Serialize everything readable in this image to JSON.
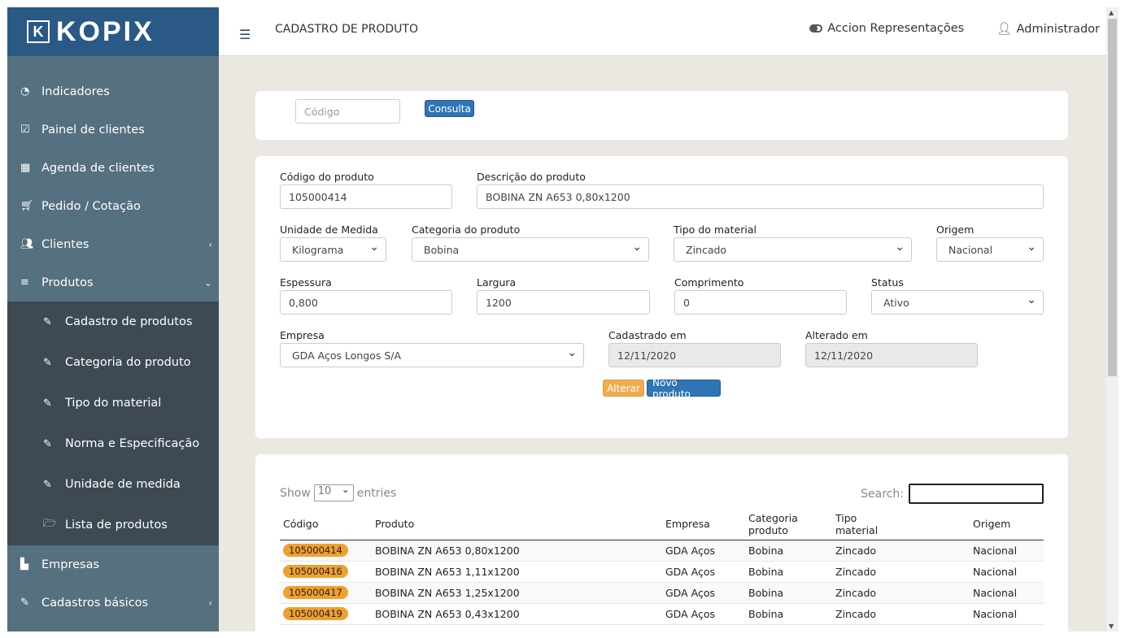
{
  "brand": {
    "mark": "K",
    "name": "KOPIX"
  },
  "header": {
    "title": "CADASTRO DE PRODUTO",
    "company": "Accion Representações",
    "user": "Administrador"
  },
  "sidebar": {
    "items": [
      {
        "label": "Indicadores",
        "icon": "dashboard-icon"
      },
      {
        "label": "Painel de clientes",
        "icon": "check-square-icon"
      },
      {
        "label": "Agenda de clientes",
        "icon": "calendar-icon"
      },
      {
        "label": "Pedido / Cotação",
        "icon": "cart-icon"
      },
      {
        "label": "Clientes",
        "icon": "users-icon"
      },
      {
        "label": "Produtos",
        "icon": "bars-icon"
      }
    ],
    "sub_items": [
      {
        "label": "Cadastro de produtos"
      },
      {
        "label": "Categoria do produto"
      },
      {
        "label": "Tipo do material"
      },
      {
        "label": "Norma e Especificação"
      },
      {
        "label": "Unidade de medida"
      },
      {
        "label": "Lista de produtos"
      }
    ],
    "bottom_items": [
      {
        "label": "Empresas"
      },
      {
        "label": "Cadastros básicos"
      }
    ]
  },
  "search_card": {
    "code_placeholder": "Código",
    "consult_label": "Consulta"
  },
  "form": {
    "codigo_label": "Código do produto",
    "codigo_value": "105000414",
    "descricao_label": "Descrição do produto",
    "descricao_value": "BOBINA ZN A653 0,80x1200",
    "unidade_label": "Unidade de Medida",
    "unidade_value": "Kilograma",
    "categoria_label": "Categoria do produto",
    "categoria_value": "Bobina",
    "tipo_label": "Tipo do material",
    "tipo_value": "Zincado",
    "origem_label": "Origem",
    "origem_value": "Nacional",
    "espessura_label": "Espessura",
    "espessura_value": "0,800",
    "largura_label": "Largura",
    "largura_value": "1200",
    "comprimento_label": "Comprimento",
    "comprimento_value": "0",
    "status_label": "Status",
    "status_value": "Ativo",
    "empresa_label": "Empresa",
    "empresa_value": "GDA Aços Longos S/A",
    "cadastrado_label": "Cadastrado em",
    "cadastrado_value": "12/11/2020",
    "alterado_label": "Alterado em",
    "alterado_value": "12/11/2020",
    "alterar_label": "Alterar",
    "novo_label": "Novo produto"
  },
  "table": {
    "show_label": "Show",
    "show_value": "10",
    "entries_label": "entries",
    "search_label": "Search:",
    "headers": {
      "codigo": "Código",
      "produto": "Produto",
      "empresa": "Empresa",
      "categoria_1": "Categoria",
      "categoria_2": "produto",
      "tipo_1": "Tipo",
      "tipo_2": "material",
      "origem": "Origem"
    },
    "rows": [
      {
        "codigo": "105000414",
        "produto": "BOBINA ZN A653 0,80x1200",
        "empresa": "GDA Aços",
        "categoria": "Bobina",
        "tipo": "Zincado",
        "origem": "Nacional"
      },
      {
        "codigo": "105000416",
        "produto": "BOBINA ZN A653 1,11x1200",
        "empresa": "GDA Aços",
        "categoria": "Bobina",
        "tipo": "Zincado",
        "origem": "Nacional"
      },
      {
        "codigo": "105000417",
        "produto": "BOBINA ZN A653 1,25x1200",
        "empresa": "GDA Aços",
        "categoria": "Bobina",
        "tipo": "Zincado",
        "origem": "Nacional"
      },
      {
        "codigo": "105000419",
        "produto": "BOBINA ZN A653 0,43x1200",
        "empresa": "GDA Aços",
        "categoria": "Bobina",
        "tipo": "Zincado",
        "origem": "Nacional"
      }
    ]
  },
  "colors": {
    "sidebar": "#55707e",
    "brand_bg": "#2a5985",
    "submenu": "#3d4a53",
    "primary": "#2f75b5",
    "warning": "#f0ad4e"
  }
}
